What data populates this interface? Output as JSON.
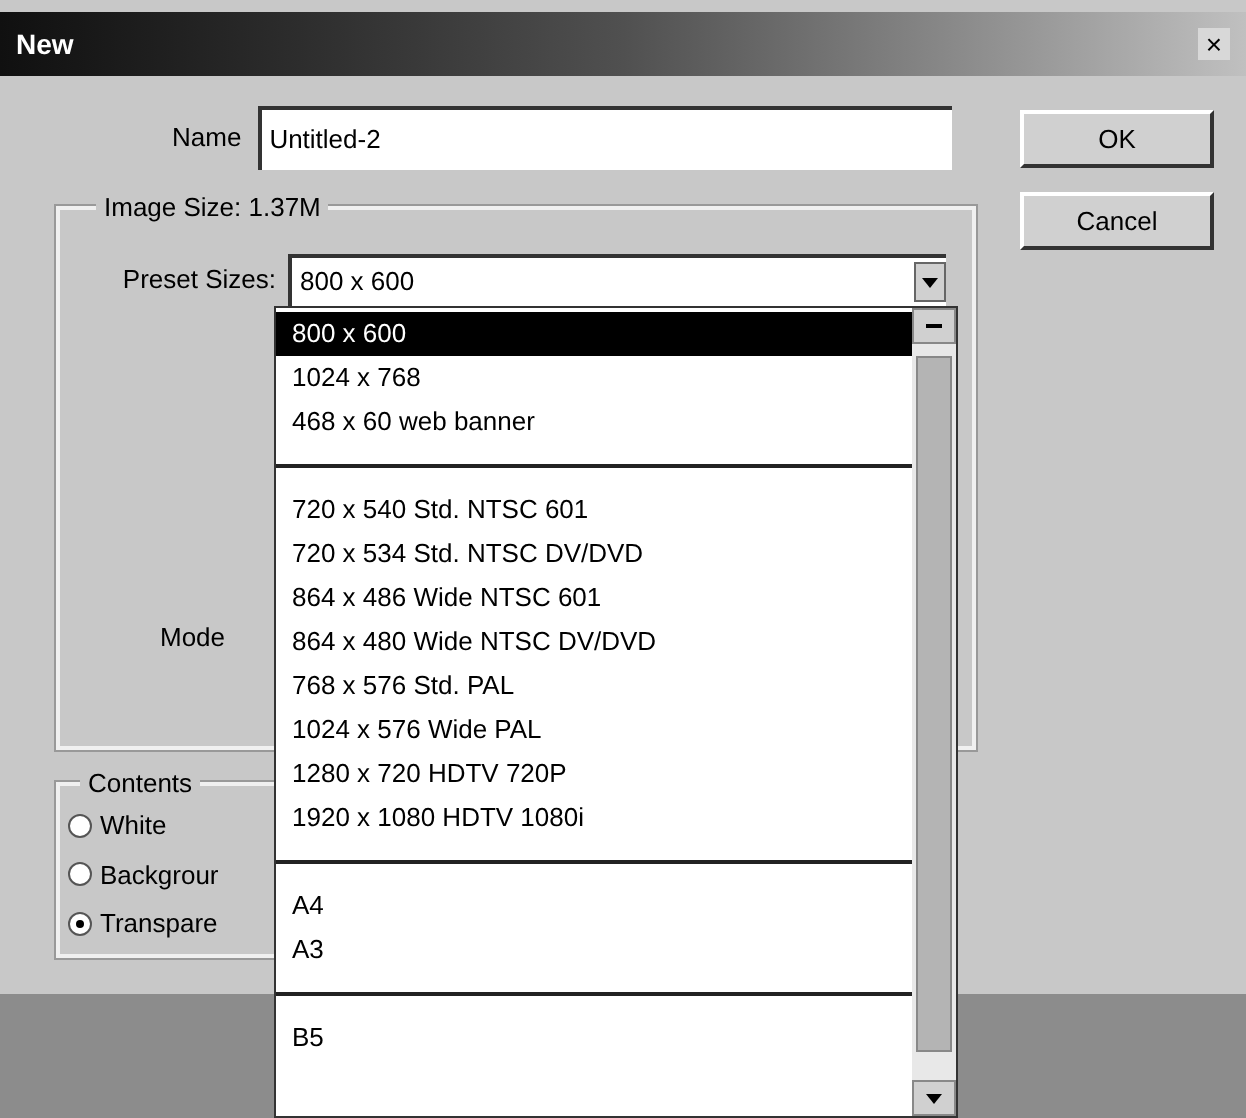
{
  "window": {
    "title": "New",
    "close": "×"
  },
  "name_field": {
    "label": "Name",
    "value": "Untitled-2"
  },
  "buttons": [
    "OK",
    "Cancel"
  ],
  "image_size": {
    "title": "Image Size: 1.37M",
    "preset_label": "Preset Sizes:",
    "preset_value": "800 x 600",
    "mode_label": "Mode"
  },
  "contents": {
    "title": "Contents",
    "options": [
      {
        "label": "White",
        "selected": false
      },
      {
        "label": "Backgrour",
        "selected": false
      },
      {
        "label": "Transpare",
        "selected": true
      }
    ]
  },
  "dropdown_list": [
    {
      "kind": "item",
      "label": "800 x 600",
      "selected": true
    },
    {
      "kind": "item",
      "label": "1024 x 768",
      "selected": false
    },
    {
      "kind": "item",
      "label": "468 x 60 web banner",
      "selected": false
    },
    {
      "kind": "separator"
    },
    {
      "kind": "item",
      "label": "720 x 540 Std. NTSC 601",
      "selected": false
    },
    {
      "kind": "item",
      "label": "720 x 534 Std. NTSC DV/DVD",
      "selected": false
    },
    {
      "kind": "item",
      "label": "864 x 486 Wide NTSC 601",
      "selected": false
    },
    {
      "kind": "item",
      "label": "864 x 480 Wide NTSC DV/DVD",
      "selected": false
    },
    {
      "kind": "item",
      "label": "768 x 576 Std. PAL",
      "selected": false
    },
    {
      "kind": "item",
      "label": "1024 x 576 Wide PAL",
      "selected": false
    },
    {
      "kind": "item",
      "label": "1280 x 720 HDTV 720P",
      "selected": false
    },
    {
      "kind": "item",
      "label": "1920 x 1080 HDTV 1080i",
      "selected": false
    },
    {
      "kind": "separator"
    },
    {
      "kind": "item",
      "label": "A4",
      "selected": false
    },
    {
      "kind": "item",
      "label": "A3",
      "selected": false
    },
    {
      "kind": "separator"
    },
    {
      "kind": "item",
      "label": "B5",
      "selected": false
    }
  ]
}
